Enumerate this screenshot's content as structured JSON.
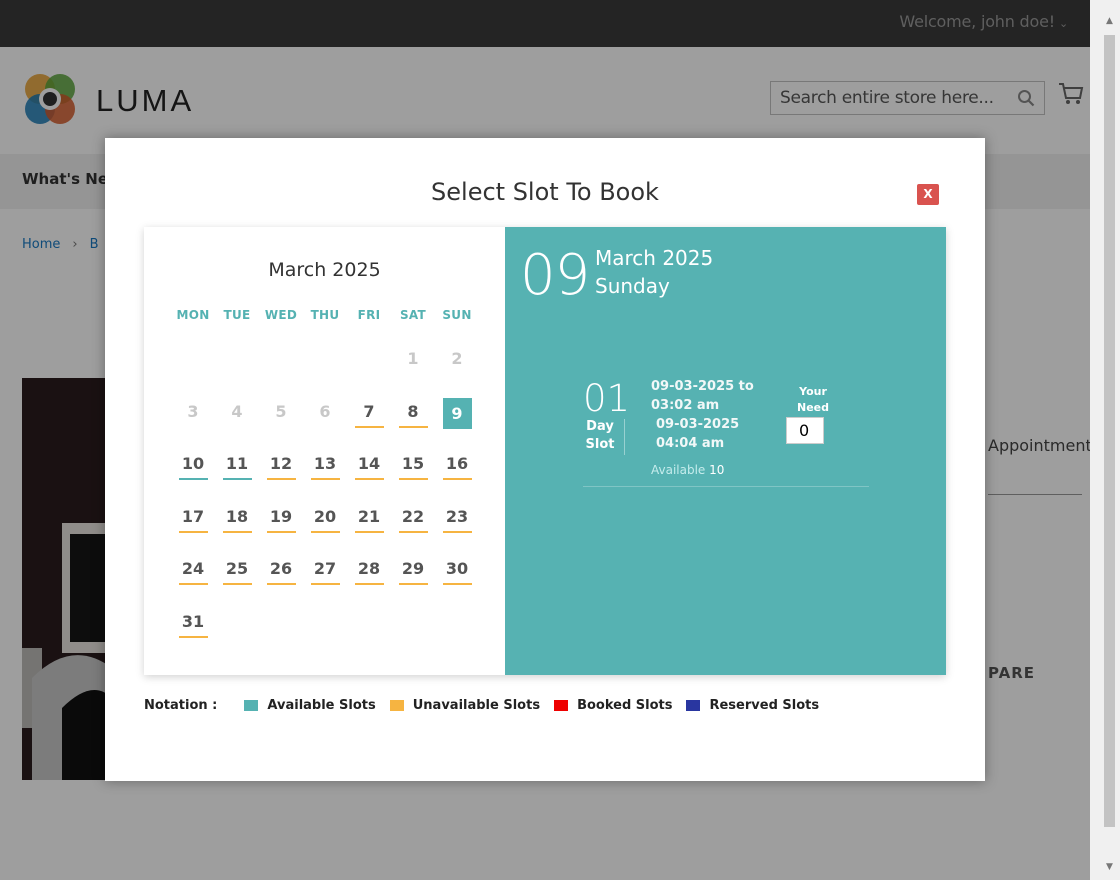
{
  "topbar": {
    "welcome": "Welcome, john doe!"
  },
  "header": {
    "logo_text": "LUMA",
    "search_placeholder": "Search entire store here..."
  },
  "nav": {
    "item": "What's New"
  },
  "breadcrumb": {
    "home": "Home",
    "next": "B"
  },
  "page": {
    "appointment": "Appointment",
    "compare": "PARE"
  },
  "modal": {
    "title": "Select Slot To Book",
    "close_label": "X",
    "calendar": {
      "month": "March 2025",
      "weekdays": [
        "MON",
        "TUE",
        "WED",
        "THU",
        "FRI",
        "SAT",
        "SUN"
      ],
      "weeks": [
        [
          {
            "d": ""
          },
          {
            "d": ""
          },
          {
            "d": ""
          },
          {
            "d": ""
          },
          {
            "d": ""
          },
          {
            "d": "1",
            "s": "disabled"
          },
          {
            "d": "2",
            "s": "disabled"
          }
        ],
        [
          {
            "d": "3",
            "s": "disabled"
          },
          {
            "d": "4",
            "s": "disabled"
          },
          {
            "d": "5",
            "s": "disabled"
          },
          {
            "d": "6",
            "s": "disabled"
          },
          {
            "d": "7",
            "s": "unavail"
          },
          {
            "d": "8",
            "s": "unavail"
          },
          {
            "d": "9",
            "s": "sel"
          }
        ],
        [
          {
            "d": "10",
            "s": "avail"
          },
          {
            "d": "11",
            "s": "avail"
          },
          {
            "d": "12",
            "s": "unavail"
          },
          {
            "d": "13",
            "s": "unavail"
          },
          {
            "d": "14",
            "s": "unavail"
          },
          {
            "d": "15",
            "s": "unavail"
          },
          {
            "d": "16",
            "s": "unavail"
          }
        ],
        [
          {
            "d": "17",
            "s": "unavail"
          },
          {
            "d": "18",
            "s": "unavail"
          },
          {
            "d": "19",
            "s": "unavail"
          },
          {
            "d": "20",
            "s": "unavail"
          },
          {
            "d": "21",
            "s": "unavail"
          },
          {
            "d": "22",
            "s": "unavail"
          },
          {
            "d": "23",
            "s": "unavail"
          }
        ],
        [
          {
            "d": "24",
            "s": "unavail"
          },
          {
            "d": "25",
            "s": "unavail"
          },
          {
            "d": "26",
            "s": "unavail"
          },
          {
            "d": "27",
            "s": "unavail"
          },
          {
            "d": "28",
            "s": "unavail"
          },
          {
            "d": "29",
            "s": "unavail"
          },
          {
            "d": "30",
            "s": "unavail"
          }
        ],
        [
          {
            "d": "31",
            "s": "unavail"
          },
          {
            "d": ""
          },
          {
            "d": ""
          },
          {
            "d": ""
          },
          {
            "d": ""
          },
          {
            "d": ""
          },
          {
            "d": ""
          }
        ]
      ]
    },
    "selected": {
      "day": "09",
      "month_year": "March 2025",
      "weekday": "Sunday",
      "slot": {
        "number": "01",
        "label_line1": "Day",
        "label_line2": "Slot",
        "time_line1": "09-03-2025 to",
        "time_line2": "03:02 am",
        "time_line3": "09-03-2025",
        "time_line4": "04:04 am",
        "available_label": "Available",
        "available_count": "10",
        "need_label_line1": "Your",
        "need_label_line2": "Need",
        "need_value": "0"
      }
    },
    "notation": {
      "label": "Notation :",
      "items": [
        {
          "label": "Available Slots",
          "color": "#55b2b2"
        },
        {
          "label": "Unavailable Slots",
          "color": "#f6b441"
        },
        {
          "label": "Booked Slots",
          "color": "#ee0000"
        },
        {
          "label": "Reserved Slots",
          "color": "#2936a0"
        }
      ]
    }
  }
}
